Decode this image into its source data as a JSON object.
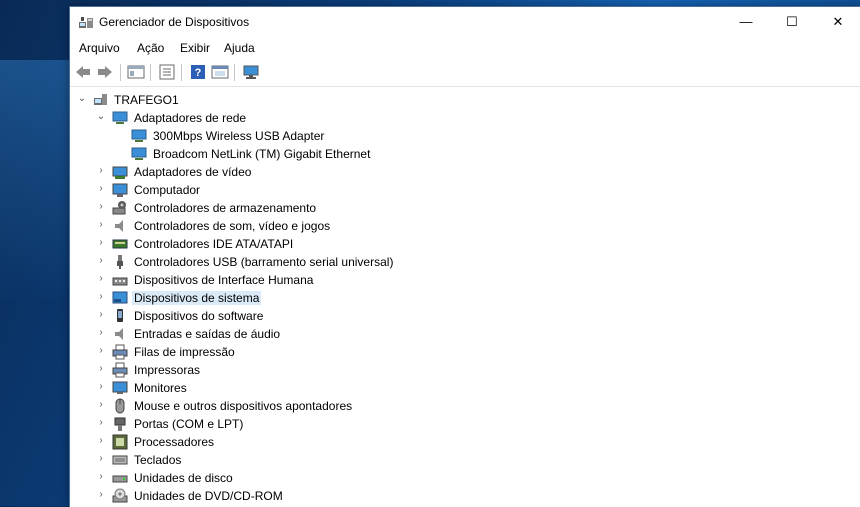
{
  "window": {
    "title": "Gerenciador de Dispositivos",
    "minimize": "—",
    "maximize": "☐",
    "close": "✕"
  },
  "menu": [
    "Arquivo",
    "Ação",
    "Exibir",
    "Ajuda"
  ],
  "tree": {
    "root": "TRAFEGO1",
    "categories": [
      {
        "label": "Adaptadores de rede",
        "expanded": true,
        "icon": "network-adapter-icon",
        "children": [
          "300Mbps Wireless USB Adapter",
          "Broadcom NetLink (TM) Gigabit Ethernet"
        ]
      },
      {
        "label": "Adaptadores de vídeo",
        "icon": "display-adapter-icon"
      },
      {
        "label": "Computador",
        "icon": "computer-icon"
      },
      {
        "label": "Controladores de armazenamento",
        "icon": "storage-controller-icon"
      },
      {
        "label": "Controladores de som, vídeo e jogos",
        "icon": "speaker-icon"
      },
      {
        "label": "Controladores IDE ATA/ATAPI",
        "icon": "ide-controller-icon"
      },
      {
        "label": "Controladores USB (barramento serial universal)",
        "icon": "usb-icon"
      },
      {
        "label": "Dispositivos de Interface Humana",
        "icon": "hid-icon"
      },
      {
        "label": "Dispositivos de sistema",
        "icon": "system-device-icon",
        "selected": true
      },
      {
        "label": "Dispositivos do software",
        "icon": "software-device-icon"
      },
      {
        "label": "Entradas e saídas de áudio",
        "icon": "audio-icon"
      },
      {
        "label": "Filas de impressão",
        "icon": "print-queue-icon"
      },
      {
        "label": "Impressoras",
        "icon": "printer-icon"
      },
      {
        "label": "Monitores",
        "icon": "monitor-icon"
      },
      {
        "label": "Mouse e outros dispositivos apontadores",
        "icon": "mouse-icon"
      },
      {
        "label": "Portas (COM e LPT)",
        "icon": "port-icon"
      },
      {
        "label": "Processadores",
        "icon": "processor-icon"
      },
      {
        "label": "Teclados",
        "icon": "keyboard-icon"
      },
      {
        "label": "Unidades de disco",
        "icon": "disk-drive-icon"
      },
      {
        "label": "Unidades de DVD/CD-ROM",
        "icon": "dvd-drive-icon"
      }
    ]
  }
}
